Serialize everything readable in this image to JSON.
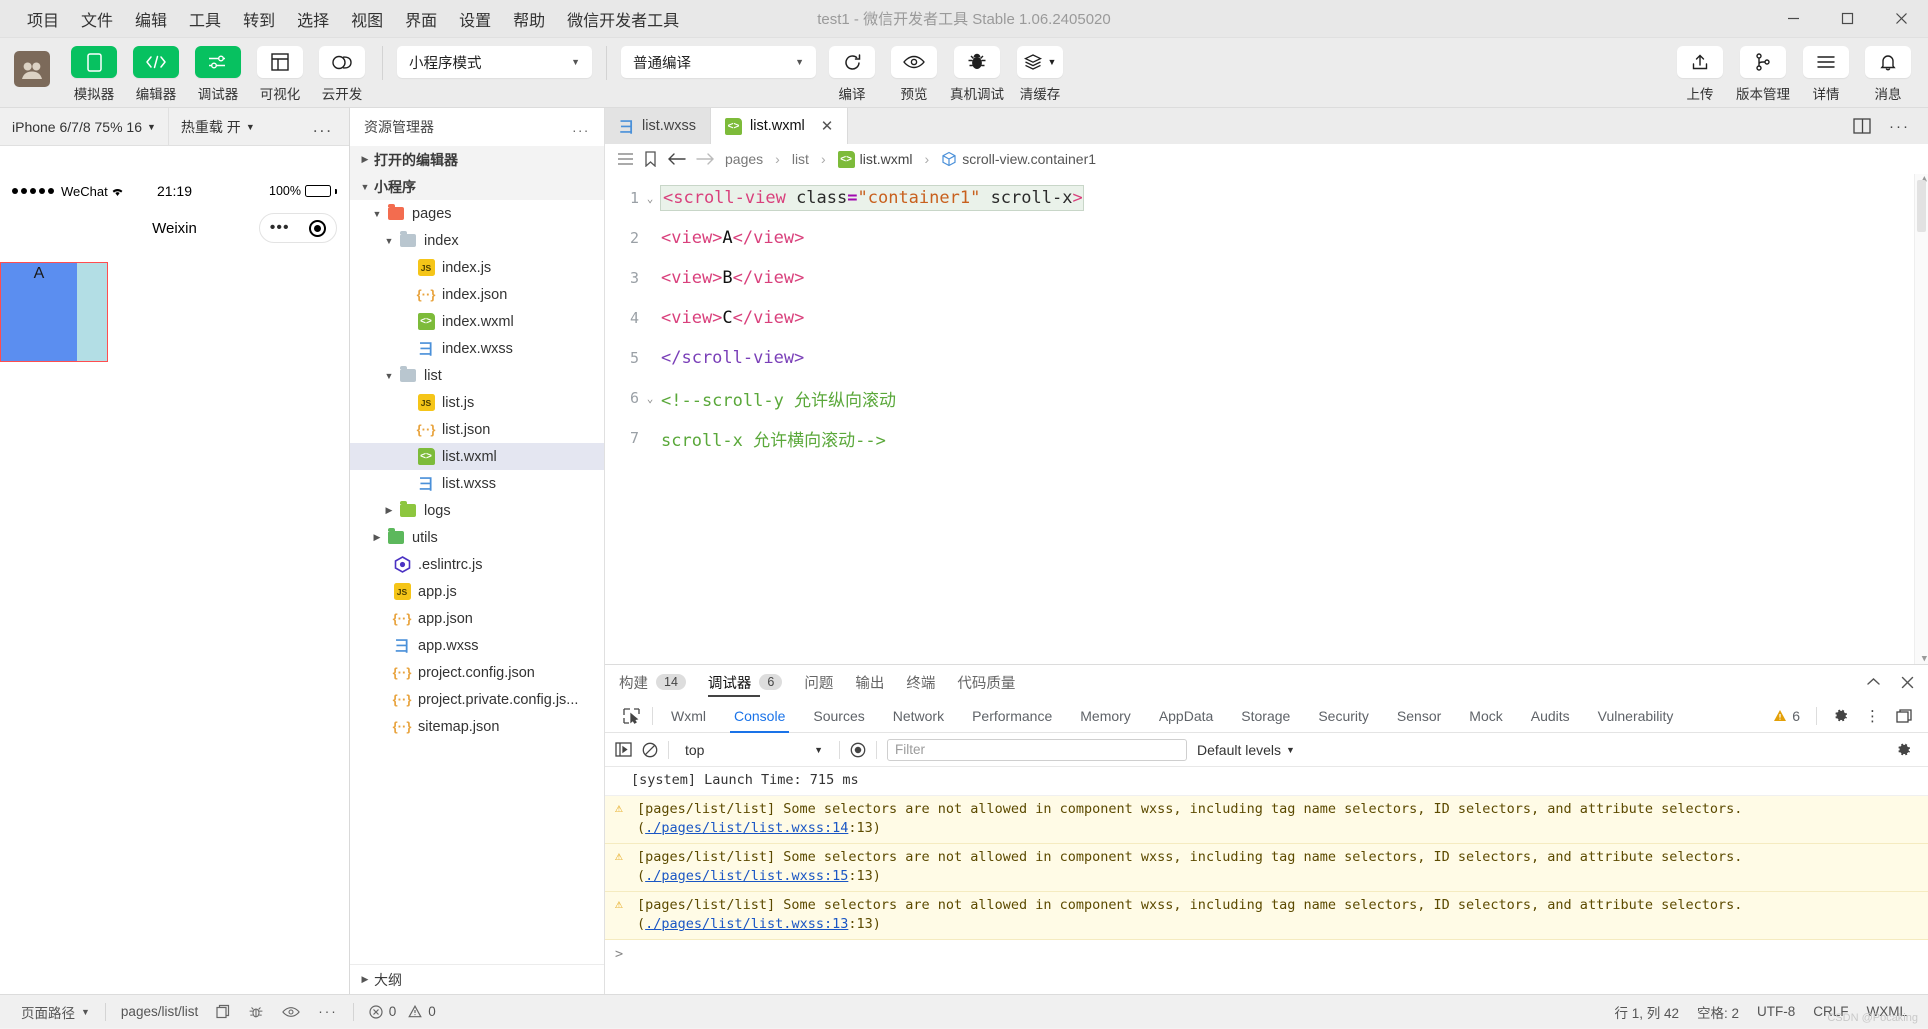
{
  "window": {
    "title": "test1 - 微信开发者工具 Stable 1.06.2405020",
    "menu": [
      "项目",
      "文件",
      "编辑",
      "工具",
      "转到",
      "选择",
      "视图",
      "界面",
      "设置",
      "帮助",
      "微信开发者工具"
    ],
    "controls": {
      "minimize": "minimize-icon",
      "maximize": "maximize-icon",
      "close": "close-icon"
    }
  },
  "toolbar": {
    "left_buttons": [
      {
        "label": "模拟器",
        "icon": "phone-icon",
        "active": true
      },
      {
        "label": "编辑器",
        "icon": "code-icon",
        "active": true
      },
      {
        "label": "调试器",
        "icon": "sliders-icon",
        "active": true
      },
      {
        "label": "可视化",
        "icon": "layout-icon",
        "active": false
      },
      {
        "label": "云开发",
        "icon": "cloud-icon",
        "active": false
      }
    ],
    "mode_select": "小程序模式",
    "compile_select": "普通编译",
    "action_buttons": [
      {
        "label": "编译",
        "icon": "refresh-icon"
      },
      {
        "label": "预览",
        "icon": "eye-icon"
      },
      {
        "label": "真机调试",
        "icon": "bug-icon"
      },
      {
        "label": "清缓存",
        "icon": "layers-icon"
      }
    ],
    "right_buttons": [
      {
        "label": "上传",
        "icon": "upload-icon"
      },
      {
        "label": "版本管理",
        "icon": "branch-icon"
      },
      {
        "label": "详情",
        "icon": "menu-icon"
      },
      {
        "label": "消息",
        "icon": "bell-icon"
      }
    ]
  },
  "simulator": {
    "device": "iPhone 6/7/8 75% 16",
    "hot_reload": "热重载 开",
    "more": "...",
    "status_carrier": "WeChat",
    "status_time": "21:19",
    "status_battery": "100%",
    "nav_title": "Weixin",
    "page_content": {
      "a": "A"
    }
  },
  "explorer": {
    "title": "资源管理器",
    "more": "...",
    "sections": [
      {
        "label": "打开的编辑器",
        "expanded": false
      },
      {
        "label": "小程序",
        "expanded": true
      }
    ],
    "tree": [
      {
        "label": "pages",
        "type": "folder-pages",
        "depth": 1,
        "expanded": true
      },
      {
        "label": "index",
        "type": "folder",
        "depth": 2,
        "expanded": true
      },
      {
        "label": "index.js",
        "type": "js",
        "depth": 3
      },
      {
        "label": "index.json",
        "type": "json",
        "depth": 3
      },
      {
        "label": "index.wxml",
        "type": "wxml",
        "depth": 3
      },
      {
        "label": "index.wxss",
        "type": "wxss",
        "depth": 3
      },
      {
        "label": "list",
        "type": "folder",
        "depth": 2,
        "expanded": true
      },
      {
        "label": "list.js",
        "type": "js",
        "depth": 3
      },
      {
        "label": "list.json",
        "type": "json",
        "depth": 3
      },
      {
        "label": "list.wxml",
        "type": "wxml",
        "depth": 3,
        "selected": true
      },
      {
        "label": "list.wxss",
        "type": "wxss",
        "depth": 3
      },
      {
        "label": "logs",
        "type": "folder-logs",
        "depth": 2,
        "expanded": false
      },
      {
        "label": "utils",
        "type": "folder-utils",
        "depth": 1,
        "expanded": false
      },
      {
        "label": ".eslintrc.js",
        "type": "eslint",
        "depth": 1
      },
      {
        "label": "app.js",
        "type": "js",
        "depth": 1
      },
      {
        "label": "app.json",
        "type": "json",
        "depth": 1
      },
      {
        "label": "app.wxss",
        "type": "wxss",
        "depth": 1
      },
      {
        "label": "project.config.json",
        "type": "json",
        "depth": 1
      },
      {
        "label": "project.private.config.js...",
        "type": "json",
        "depth": 1
      },
      {
        "label": "sitemap.json",
        "type": "json",
        "depth": 1
      }
    ],
    "outline": "大纲"
  },
  "editor": {
    "tabs": [
      {
        "label": "list.wxss",
        "icon": "wxss-icon",
        "active": false,
        "closable": false
      },
      {
        "label": "list.wxml",
        "icon": "wxml-icon",
        "active": true,
        "closable": true
      }
    ],
    "breadcrumb": [
      "pages",
      "list",
      "list.wxml",
      "scroll-view.container1"
    ],
    "lines": [
      {
        "n": "1",
        "fold": true
      },
      {
        "n": "2",
        "fold": false
      },
      {
        "n": "3",
        "fold": false
      },
      {
        "n": "4",
        "fold": false
      },
      {
        "n": "5",
        "fold": false
      },
      {
        "n": "6",
        "fold": true
      },
      {
        "n": "7",
        "fold": false
      }
    ],
    "code": {
      "l1_a": "<scroll-view",
      "l1_b": " class",
      "l1_c": "=",
      "l1_d": "\"container1\"",
      "l1_e": " scroll-x",
      "l1_f": ">",
      "l2_open": "<view>",
      "l2_txt": "A",
      "l2_close": "</view>",
      "l3_open": "<view>",
      "l3_txt": "B",
      "l3_close": "</view>",
      "l4_open": "<view>",
      "l4_txt": "C",
      "l4_close": "</view>",
      "l5": "</scroll-view>",
      "l6": "<!--scroll-y 允许纵向滚动",
      "l7": "scroll-x 允许横向滚动-->"
    }
  },
  "devtools": {
    "panels": [
      {
        "label": "构建",
        "badge": "14",
        "active": false
      },
      {
        "label": "调试器",
        "badge": "6",
        "active": true
      },
      {
        "label": "问题",
        "badge": "",
        "active": false
      },
      {
        "label": "输出",
        "badge": "",
        "active": false
      },
      {
        "label": "终端",
        "badge": "",
        "active": false
      },
      {
        "label": "代码质量",
        "badge": "",
        "active": false
      }
    ],
    "subtabs": [
      "Wxml",
      "Console",
      "Sources",
      "Network",
      "Performance",
      "Memory",
      "AppData",
      "Storage",
      "Security",
      "Sensor",
      "Mock",
      "Audits",
      "Vulnerability"
    ],
    "active_subtab": "Console",
    "warning_count": "6",
    "console": {
      "context": "top",
      "filter_placeholder": "Filter",
      "levels": "Default levels",
      "messages": [
        {
          "type": "system",
          "text": "[system] Launch Time: 715 ms"
        },
        {
          "type": "warning",
          "text": "[pages/list/list] Some selectors are not allowed in component wxss, including tag name selectors, ID selectors, and attribute selectors.(",
          "link": "./pages/list/list.wxss:14",
          "tail": ":13)"
        },
        {
          "type": "warning",
          "text": "[pages/list/list] Some selectors are not allowed in component wxss, including tag name selectors, ID selectors, and attribute selectors.(",
          "link": "./pages/list/list.wxss:15",
          "tail": ":13)"
        },
        {
          "type": "warning",
          "text": "[pages/list/list] Some selectors are not allowed in component wxss, including tag name selectors, ID selectors, and attribute selectors.(",
          "link": "./pages/list/list.wxss:13",
          "tail": ":13)"
        }
      ],
      "prompt": ">"
    }
  },
  "statusbar": {
    "page_path_label": "页面路径",
    "page_path": "pages/list/list",
    "errors": "0",
    "warnings": "0",
    "cursor": "行 1, 列 42",
    "spaces": "空格: 2",
    "encoding": "UTF-8",
    "eol": "CRLF",
    "language": "WXML",
    "watermark": "CSDN @Pocaking"
  }
}
